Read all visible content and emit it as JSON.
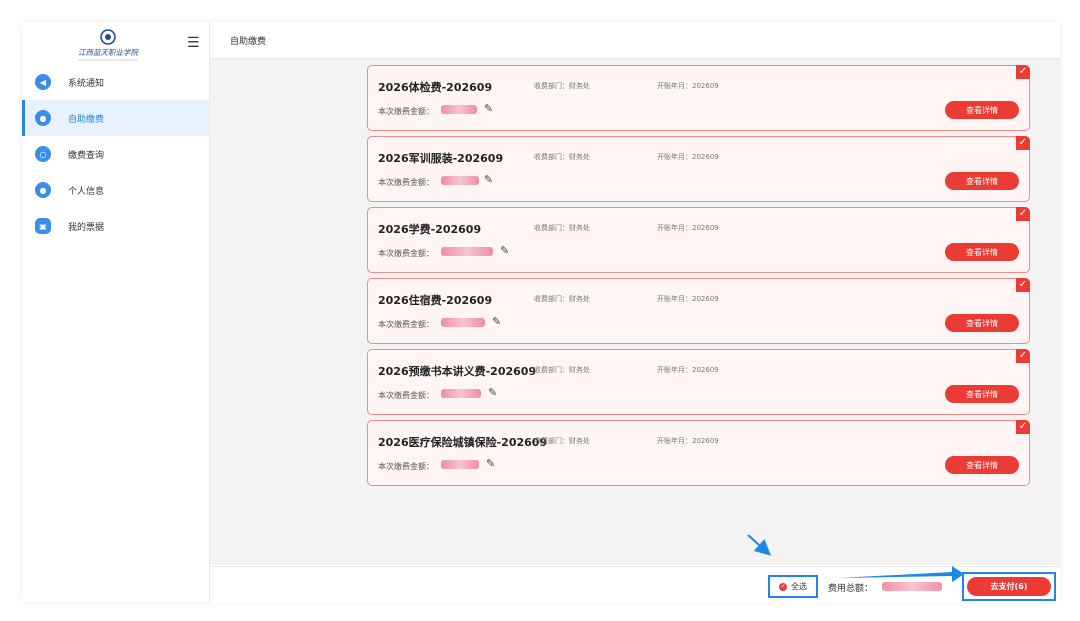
{
  "school": {
    "logo_text": "江西蓝天职业学院"
  },
  "sidebar": {
    "items": [
      {
        "label": "系统通知",
        "icon": "bell-icon"
      },
      {
        "label": "自助缴费",
        "icon": "payment-icon"
      },
      {
        "label": "缴费查询",
        "icon": "search-icon"
      },
      {
        "label": "个人信息",
        "icon": "user-icon"
      },
      {
        "label": "我的票据",
        "icon": "receipt-icon"
      }
    ],
    "active_index": 1
  },
  "header": {
    "title": "自助缴费"
  },
  "fee_items": [
    {
      "title": "2026体检费-202609",
      "dept": "收费部门：财务处",
      "period": "开账年月：202609",
      "amount_label": "本次缴费金额：",
      "detail_label": "查看详情"
    },
    {
      "title": "2026军训服装-202609",
      "dept": "收费部门：财务处",
      "period": "开账年月：202609",
      "amount_label": "本次缴费金额：",
      "detail_label": "查看详情"
    },
    {
      "title": "2026学费-202609",
      "dept": "收费部门：财务处",
      "period": "开账年月：202609",
      "amount_label": "本次缴费金额：",
      "detail_label": "查看详情"
    },
    {
      "title": "2026住宿费-202609",
      "dept": "收费部门：财务处",
      "period": "开账年月：202609",
      "amount_label": "本次缴费金额：",
      "detail_label": "查看详情"
    },
    {
      "title": "2026预缴书本讲义费-202609",
      "dept": "收费部门：财务处",
      "period": "开账年月：202609",
      "amount_label": "本次缴费金额：",
      "detail_label": "查看详情"
    },
    {
      "title": "2026医疗保险城镇保险-202609",
      "dept": "收费部门：财务处",
      "period": "开账年月：202609",
      "amount_label": "本次缴费金额：",
      "detail_label": "查看详情"
    }
  ],
  "footer": {
    "select_all": "全选",
    "total_label": "费用总额：",
    "pay_label": "去支付(6)"
  },
  "colors": {
    "accent_red": "#ea3b34",
    "card_border": "#f08c86",
    "card_bg": "#fff5f5",
    "active_blue": "#2a86e0",
    "annotation_blue": "#1e88e5"
  }
}
